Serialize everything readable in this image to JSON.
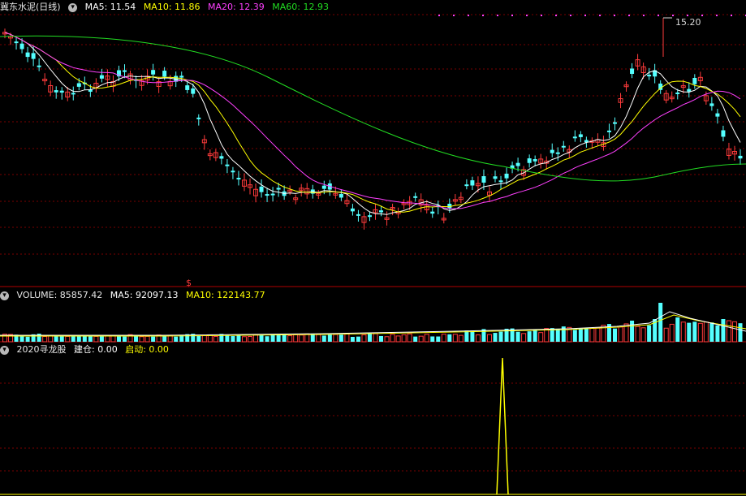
{
  "main_panel": {
    "stock_name": "冀东水泥(日线)",
    "ma5": "MA5: 11.54",
    "ma10": "MA10: 11.86",
    "ma20": "MA20: 12.39",
    "ma60": "MA60: 12.93",
    "high_label": "15.20",
    "signal_marker": "$"
  },
  "volume_panel": {
    "volume": "VOLUME: 85857.42",
    "ma5": "MA5: 92097.13",
    "ma10": "MA10: 122143.77"
  },
  "indicator_panel": {
    "name": "2020寻龙股",
    "build": "建仓: 0.00",
    "start": "启动: 0.00"
  },
  "colors": {
    "up": "#ff3b3b",
    "down": "#54ffff",
    "ma5": "#ffffff",
    "ma10": "#ffff00",
    "ma20": "#ff40ff",
    "ma60": "#22dd22",
    "grid": "#7a0000"
  },
  "chart_data": {
    "type": "candlestick",
    "days": 130,
    "price_scale": [
      10.0,
      15.2
    ],
    "series_names": [
      "MA5",
      "MA10",
      "MA20",
      "MA60",
      "VOLUME",
      "建仓",
      "启动"
    ]
  }
}
